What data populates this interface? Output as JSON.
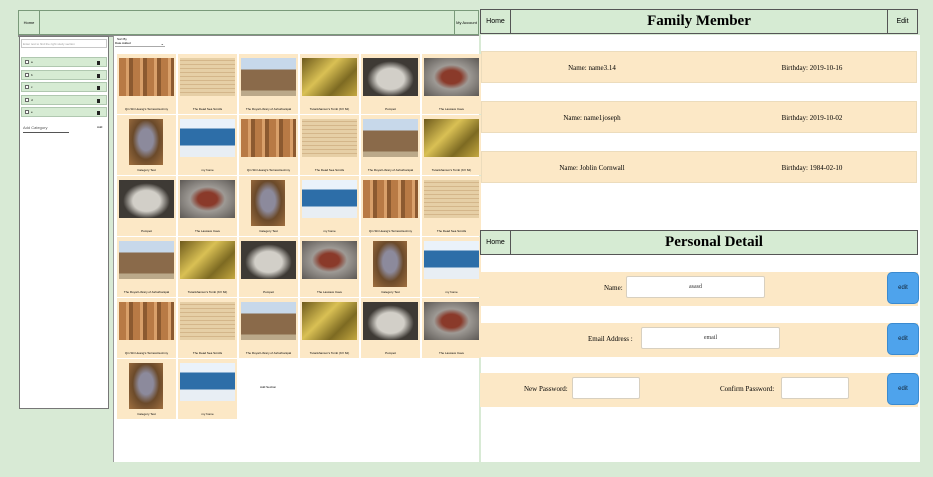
{
  "left_app": {
    "topbar": {
      "home_label": "Home",
      "profile_label": "My Account"
    },
    "sidebar": {
      "search_placeholder": "Enter text to find the right study section",
      "categories": [
        {
          "label": "a"
        },
        {
          "label": "b"
        },
        {
          "label": "c"
        },
        {
          "label": "d"
        },
        {
          "label": "e"
        }
      ],
      "add_category_placeholder": "Add Category",
      "add_label": "Add"
    },
    "main": {
      "sort_label": "Sort By",
      "sort_value": "Date Added",
      "add_section_label": "Add Section",
      "tiles": [
        {
          "caption": "Qin Shi Huang's Terracotta Army",
          "thumb": "warriors"
        },
        {
          "caption": "The Dead Sea Scrolls",
          "thumb": "scrolls"
        },
        {
          "caption": "The Royal Library of Ashurbanipal",
          "thumb": "library"
        },
        {
          "caption": "Tutankhamun's Tomb (KV 62)",
          "thumb": "tomb"
        },
        {
          "caption": "Pompeii",
          "thumb": "pompeii"
        },
        {
          "caption": "The Lascaux Cave",
          "thumb": "cave"
        },
        {
          "caption": "Category Test",
          "thumb": "frame"
        },
        {
          "caption": "my home",
          "thumb": "sky"
        },
        {
          "caption": "Qin Shi Huang's Terracotta Army",
          "thumb": "warriors"
        },
        {
          "caption": "The Dead Sea Scrolls",
          "thumb": "scrolls"
        },
        {
          "caption": "The Royal Library of Ashurbanipal",
          "thumb": "library"
        },
        {
          "caption": "Tutankhamun's Tomb (KV 62)",
          "thumb": "tomb"
        },
        {
          "caption": "Pompeii",
          "thumb": "pompeii"
        },
        {
          "caption": "The Lascaux Cave",
          "thumb": "cave"
        },
        {
          "caption": "Category Test",
          "thumb": "frame"
        },
        {
          "caption": "my home",
          "thumb": "sky"
        },
        {
          "caption": "Qin Shi Huang's Terracotta Army",
          "thumb": "warriors"
        },
        {
          "caption": "The Dead Sea Scrolls",
          "thumb": "scrolls"
        },
        {
          "caption": "The Royal Library of Ashurbanipal",
          "thumb": "library"
        },
        {
          "caption": "Tutankhamun's Tomb (KV 62)",
          "thumb": "tomb"
        },
        {
          "caption": "Pompeii",
          "thumb": "pompeii"
        },
        {
          "caption": "The Lascaux Cave",
          "thumb": "cave"
        },
        {
          "caption": "Category Test",
          "thumb": "frame"
        },
        {
          "caption": "my home",
          "thumb": "sky"
        },
        {
          "caption": "Qin Shi Huang's Terracotta Army",
          "thumb": "warriors"
        },
        {
          "caption": "The Dead Sea Scrolls",
          "thumb": "scrolls"
        },
        {
          "caption": "The Royal Library of Ashurbanipal",
          "thumb": "library"
        },
        {
          "caption": "Tutankhamun's Tomb (KV 62)",
          "thumb": "tomb"
        },
        {
          "caption": "Pompeii",
          "thumb": "pompeii"
        },
        {
          "caption": "The Lascaux Cave",
          "thumb": "cave"
        },
        {
          "caption": "Category Test",
          "thumb": "frame"
        },
        {
          "caption": "my home",
          "thumb": "sky"
        }
      ]
    }
  },
  "right_app": {
    "family": {
      "home_label": "Home",
      "title": "Family Member",
      "edit_label": "Edit",
      "members": [
        {
          "name": "Name: name3.14",
          "birthday": "Birthday: 2019-10-16"
        },
        {
          "name": "Name: name1joseph",
          "birthday": "Birthday: 2019-10-02"
        },
        {
          "name": "Name: Joblin Cornwall",
          "birthday": "Birthday: 1984-02-10"
        }
      ]
    },
    "personal": {
      "home_label": "Home",
      "title": "Personal Detail",
      "name_label": "Name:",
      "name_value": "asasd",
      "email_label": "Email Address :",
      "email_value": "email",
      "new_password_label": "New Password:",
      "confirm_password_label": "Confirm Password:",
      "edit_label": "edit"
    }
  },
  "colors": {
    "header_green": "#d6ebd3",
    "background_green": "#d8ead5",
    "row_beige": "#fce8c6",
    "edit_blue": "#4ea3ec"
  }
}
